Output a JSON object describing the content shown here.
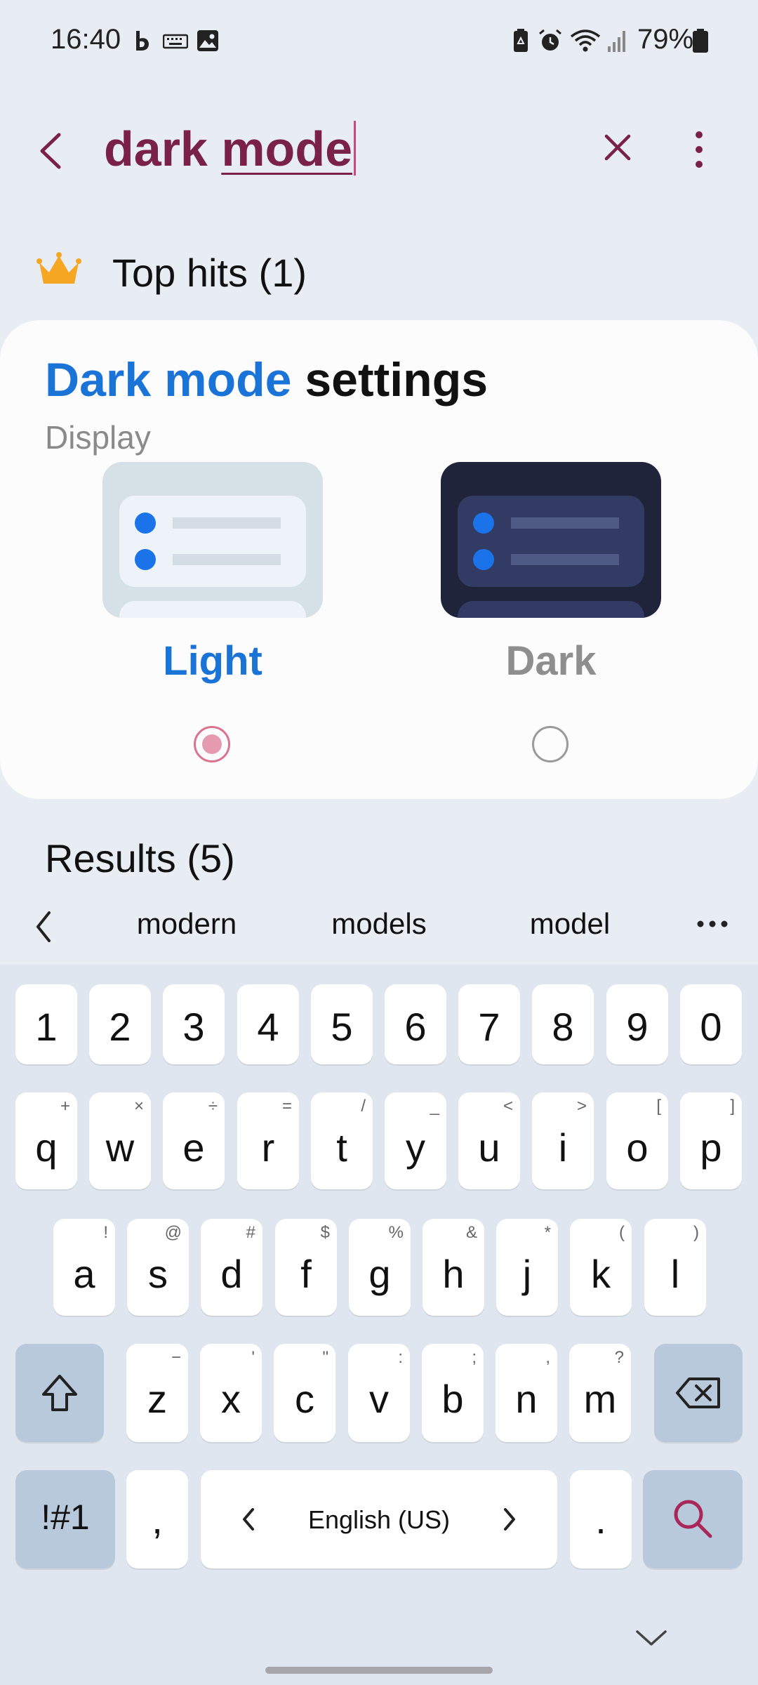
{
  "status_bar": {
    "time": "16:40",
    "icons": [
      "bixby-icon",
      "keyboard-icon",
      "image-icon",
      "battery-saver-icon",
      "alarm-icon",
      "wifi-icon",
      "signal-icon",
      "battery-icon"
    ],
    "battery_percent": "79%"
  },
  "search": {
    "query_part1": "dark ",
    "query_part2": "mode",
    "accent": "#7a2148"
  },
  "top_hits": {
    "label": "Top hits (1)"
  },
  "card": {
    "title_highlight": "Dark mode",
    "title_rest": " settings",
    "subtitle": "Display",
    "options": [
      {
        "label": "Light",
        "selected": true
      },
      {
        "label": "Dark",
        "selected": false
      }
    ],
    "highlight_color": "#1a73d6"
  },
  "results": {
    "label": "Results (5)"
  },
  "suggestions": {
    "words": [
      "modern",
      "models",
      "model"
    ]
  },
  "keyboard": {
    "number_row": [
      "1",
      "2",
      "3",
      "4",
      "5",
      "6",
      "7",
      "8",
      "9",
      "0"
    ],
    "row1": [
      {
        "k": "q",
        "h": "+"
      },
      {
        "k": "w",
        "h": "×"
      },
      {
        "k": "e",
        "h": "÷"
      },
      {
        "k": "r",
        "h": "="
      },
      {
        "k": "t",
        "h": "/"
      },
      {
        "k": "y",
        "h": "_"
      },
      {
        "k": "u",
        "h": "<"
      },
      {
        "k": "i",
        "h": ">"
      },
      {
        "k": "o",
        "h": "["
      },
      {
        "k": "p",
        "h": "]"
      }
    ],
    "row2": [
      {
        "k": "a",
        "h": "!"
      },
      {
        "k": "s",
        "h": "@"
      },
      {
        "k": "d",
        "h": "#"
      },
      {
        "k": "f",
        "h": "$"
      },
      {
        "k": "g",
        "h": "%"
      },
      {
        "k": "h",
        "h": "&"
      },
      {
        "k": "j",
        "h": "*"
      },
      {
        "k": "k",
        "h": "("
      },
      {
        "k": "l",
        "h": ")"
      }
    ],
    "row3": [
      {
        "k": "z",
        "h": "−"
      },
      {
        "k": "x",
        "h": "'"
      },
      {
        "k": "c",
        "h": "\""
      },
      {
        "k": "v",
        "h": ":"
      },
      {
        "k": "b",
        "h": ";"
      },
      {
        "k": "n",
        "h": ","
      },
      {
        "k": "m",
        "h": "?"
      }
    ],
    "symbols_label": "!#1",
    "comma": ",",
    "period": ".",
    "space_label": "English (US)"
  }
}
